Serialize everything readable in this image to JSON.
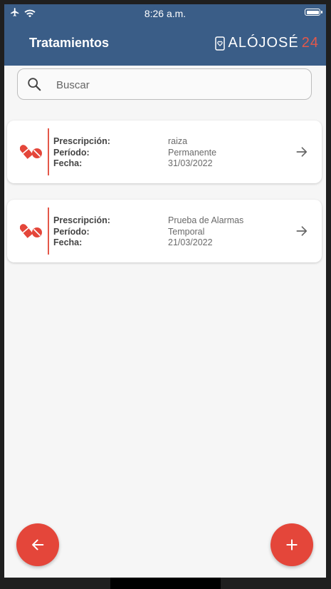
{
  "status_bar": {
    "time": "8:26 a.m.",
    "icons": [
      "airplane-icon",
      "wifi-icon",
      "battery-icon"
    ]
  },
  "header": {
    "title": "Tratamientos",
    "brand_text": "ALÓJOSÉ",
    "brand_number": "24"
  },
  "search": {
    "placeholder": "Buscar",
    "value": ""
  },
  "labels": {
    "prescription": "Prescripción:",
    "period": "Período:",
    "date": "Fecha:"
  },
  "treatments": [
    {
      "prescription": "raiza",
      "period": "Permanente",
      "date": "31/03/2022"
    },
    {
      "prescription": "Prueba de Alarmas",
      "period": "Temporal",
      "date": "21/03/2022"
    }
  ],
  "colors": {
    "header": "#3a5d87",
    "accent": "#e4463a",
    "background": "#f6f6f6"
  }
}
